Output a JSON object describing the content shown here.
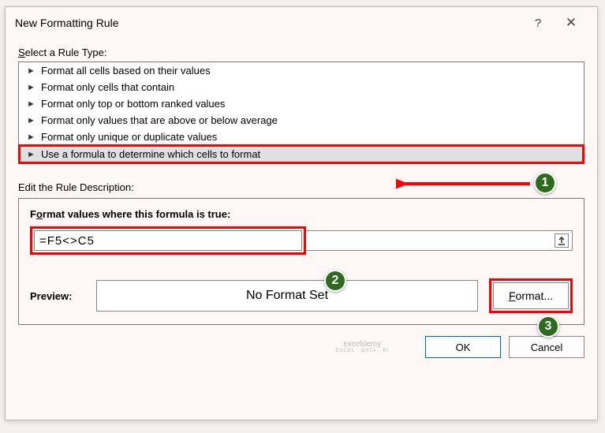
{
  "title": "New Formatting Rule",
  "help": "?",
  "close": "✕",
  "section1_label": "Select a Rule Type:",
  "section1_underline": "S",
  "rule_types": [
    "Format all cells based on their values",
    "Format only cells that contain",
    "Format only top or bottom ranked values",
    "Format only values that are above or below average",
    "Format only unique or duplicate values",
    "Use a formula to determine which cells to format"
  ],
  "section2_label": "Edit the Rule Description:",
  "subhead": "Format values where this formula is true:",
  "subhead_underline": "o",
  "formula_value": "=F5<>C5",
  "preview_label": "Preview:",
  "preview_text": "No Format Set",
  "format_btn": "Format...",
  "format_underline": "F",
  "ok_btn": "OK",
  "cancel_btn": "Cancel",
  "watermark_top": "exceldemy",
  "watermark_bottom": "EXCEL · DATA · BI",
  "badges": {
    "one": "1",
    "two": "2",
    "three": "3"
  }
}
